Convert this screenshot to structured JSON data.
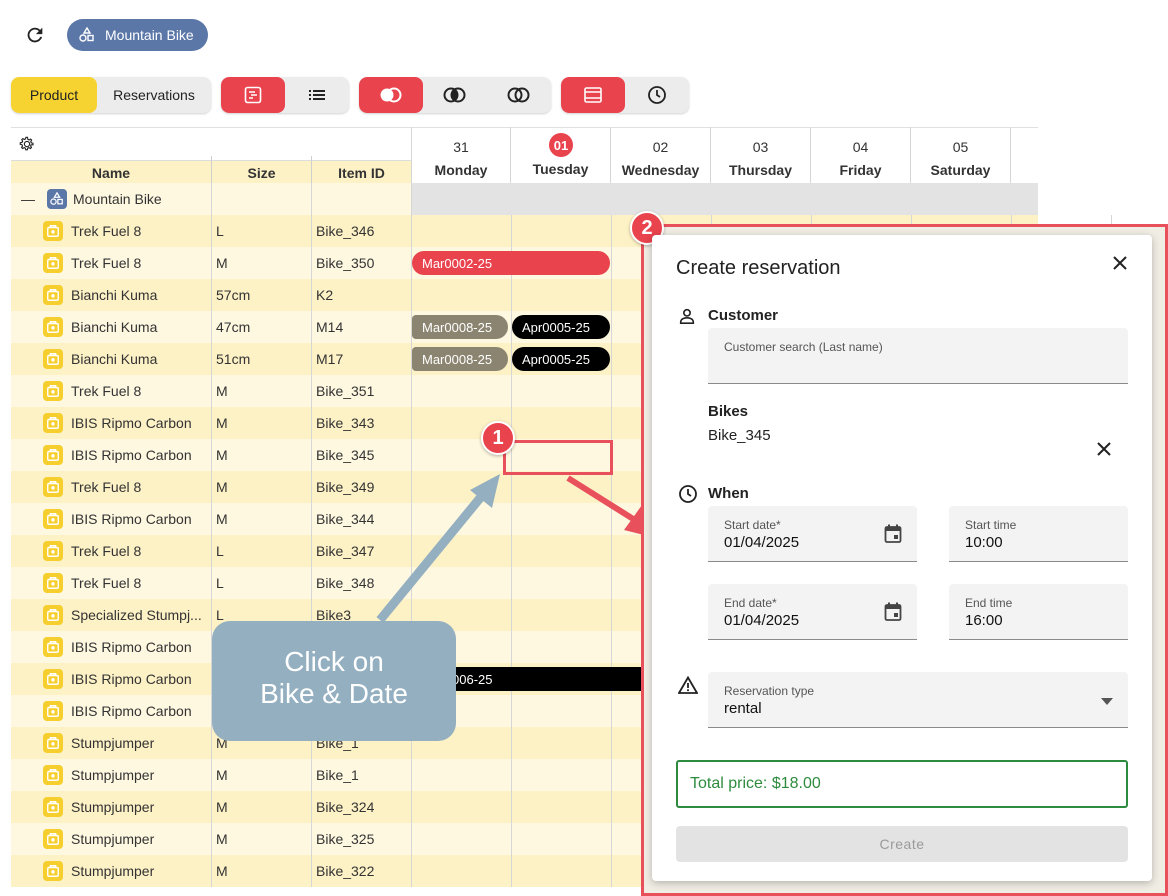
{
  "topbar": {
    "chip_label": "Mountain Bike"
  },
  "toolbar": {
    "product": "Product",
    "reservations": "Reservations"
  },
  "columns": {
    "name": "Name",
    "size": "Size",
    "item_id": "Item ID"
  },
  "group": {
    "label": "Mountain Bike",
    "collapse": "—"
  },
  "days": [
    {
      "num": "31",
      "name": "Monday"
    },
    {
      "num": "01",
      "name": "Tuesday"
    },
    {
      "num": "02",
      "name": "Wednesday"
    },
    {
      "num": "03",
      "name": "Thursday"
    },
    {
      "num": "04",
      "name": "Friday"
    },
    {
      "num": "05",
      "name": "Saturday"
    }
  ],
  "rows": [
    {
      "name": "Trek Fuel 8",
      "size": "L",
      "id": "Bike_346"
    },
    {
      "name": "Trek Fuel 8",
      "size": "M",
      "id": "Bike_350"
    },
    {
      "name": "Bianchi Kuma",
      "size": "57cm",
      "id": "K2"
    },
    {
      "name": "Bianchi Kuma",
      "size": "47cm",
      "id": "M14"
    },
    {
      "name": "Bianchi Kuma",
      "size": "51cm",
      "id": "M17"
    },
    {
      "name": "Trek Fuel 8",
      "size": "M",
      "id": "Bike_351"
    },
    {
      "name": "IBIS Ripmo Carbon",
      "size": "M",
      "id": "Bike_343"
    },
    {
      "name": "IBIS Ripmo Carbon",
      "size": "M",
      "id": "Bike_345"
    },
    {
      "name": "Trek Fuel 8",
      "size": "M",
      "id": "Bike_349"
    },
    {
      "name": "IBIS Ripmo Carbon",
      "size": "M",
      "id": "Bike_344"
    },
    {
      "name": "Trek Fuel 8",
      "size": "L",
      "id": "Bike_347"
    },
    {
      "name": "Trek Fuel 8",
      "size": "L",
      "id": "Bike_348"
    },
    {
      "name": "Specialized Stumpj...",
      "size": "L",
      "id": "Bike3"
    },
    {
      "name": "IBIS Ripmo Carbon",
      "size": "",
      "id": ""
    },
    {
      "name": "IBIS Ripmo Carbon",
      "size": "",
      "id": ""
    },
    {
      "name": "IBIS Ripmo Carbon",
      "size": "",
      "id": ""
    },
    {
      "name": "Stumpjumper",
      "size": "M",
      "id": "Bike_1"
    },
    {
      "name": "Stumpjumper",
      "size": "M",
      "id": "Bike_1"
    },
    {
      "name": "Stumpjumper",
      "size": "M",
      "id": "Bike_324"
    },
    {
      "name": "Stumpjumper",
      "size": "M",
      "id": "Bike_325"
    },
    {
      "name": "Stumpjumper",
      "size": "M",
      "id": "Bike_322"
    }
  ],
  "reservations": {
    "r1": "Mar0002-25",
    "r2": "Mar0008-25",
    "r3": "Apr0005-25",
    "r4": "Mar0008-25",
    "r5": "Apr0005-25",
    "r6": "006-25"
  },
  "callout": {
    "line1": "Click on",
    "line2": "Bike & Date"
  },
  "badges": {
    "one": "1",
    "two": "2"
  },
  "dialog": {
    "title": "Create reservation",
    "customer_label": "Customer",
    "customer_search_label": "Customer search (Last name)",
    "bikes_label": "Bikes",
    "bike_value": "Bike_345",
    "when_label": "When",
    "start_date_label": "Start date*",
    "start_date": "01/04/2025",
    "start_time_label": "Start time",
    "start_time": "10:00",
    "end_date_label": "End date*",
    "end_date": "01/04/2025",
    "end_time_label": "End time",
    "end_time": "16:00",
    "res_type_label": "Reservation type",
    "res_type": "rental",
    "total_price": "Total price: $18.00",
    "create_button": "Create"
  },
  "colors": {
    "accent": "#e9434d",
    "chip": "#5b77a8",
    "yellow": "#f6d330",
    "green": "#2e8b3e"
  }
}
